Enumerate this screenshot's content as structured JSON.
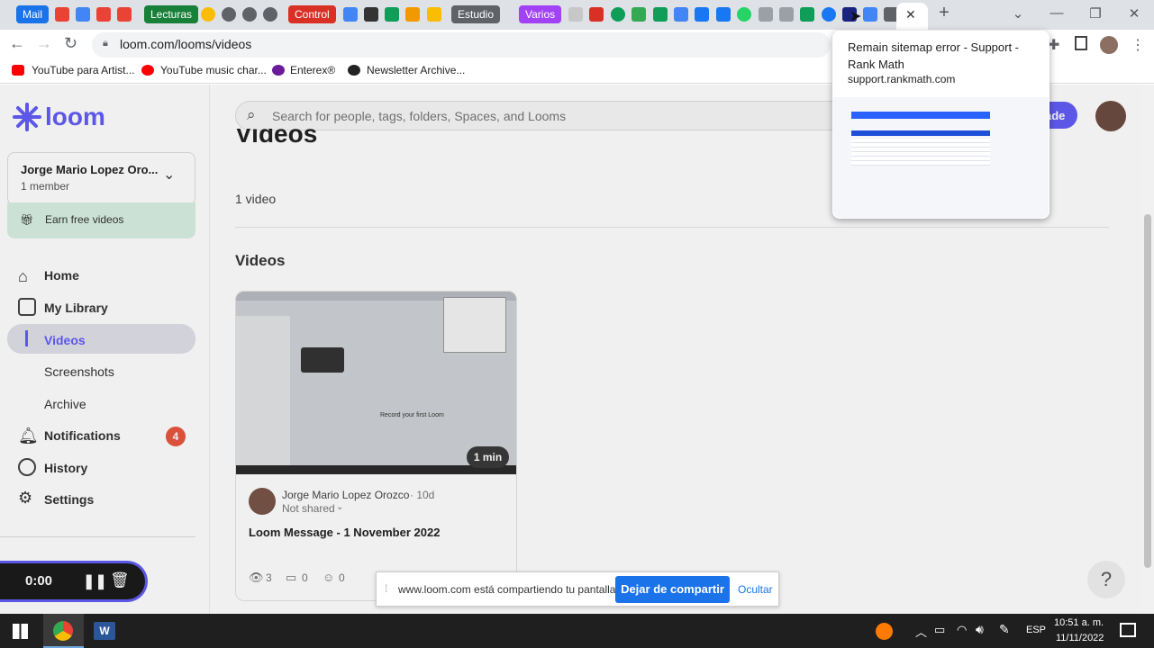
{
  "browser": {
    "tab_pills": [
      {
        "label": "Mail",
        "color": "#1a73e8"
      },
      {
        "label": "Lecturas",
        "color": "#188038"
      },
      {
        "label": "Control",
        "color": "#d93025"
      },
      {
        "label": "Estudio",
        "color": "#5f6368"
      },
      {
        "label": "Varios",
        "color": "#a142f4"
      }
    ],
    "url": "loom.com/looms/videos",
    "bookmarks": [
      {
        "label": "YouTube para Artist..."
      },
      {
        "label": "YouTube music char..."
      },
      {
        "label": "Enterex®"
      },
      {
        "label": "Newsletter Archive..."
      }
    ],
    "tooltip": {
      "title": "Remain sitemap error - Support - Rank Math",
      "domain": "support.rankmath.com"
    }
  },
  "loom": {
    "logo": "loom",
    "search_placeholder": "Search for people, tags, folders, Spaces, and Looms",
    "upgrade_label": "ade",
    "workspace": {
      "name": "Jorge Mario Lopez Oro...",
      "members": "1 member"
    },
    "earn_label": "Earn free videos",
    "nav": [
      {
        "label": "Home"
      },
      {
        "label": "My Library"
      },
      {
        "label": "Videos"
      },
      {
        "label": "Screenshots"
      },
      {
        "label": "Archive"
      },
      {
        "label": "Notifications",
        "badge": "4"
      },
      {
        "label": "History"
      },
      {
        "label": "Settings"
      }
    ],
    "page_title": "Videos",
    "video_count": "1 video",
    "section_title": "Videos",
    "video": {
      "duration": "1 min",
      "owner": "Jorge Mario Lopez Orozco",
      "age": "· 10d",
      "share_status": "Not shared",
      "title": "Loom Message - 1 November 2022",
      "views": "3",
      "comments": "0",
      "reactions": "0",
      "thumb_text": "Record your first Loom"
    },
    "recorder": {
      "time": "0:00"
    },
    "help": "?"
  },
  "share_bar": {
    "message": "www.loom.com está compartiendo tu pantalla.",
    "stop_label": "Dejar de compartir",
    "hide_label": "Ocultar"
  },
  "taskbar": {
    "lang": "ESP",
    "time": "10:51 a. m.",
    "date": "11/11/2022"
  }
}
